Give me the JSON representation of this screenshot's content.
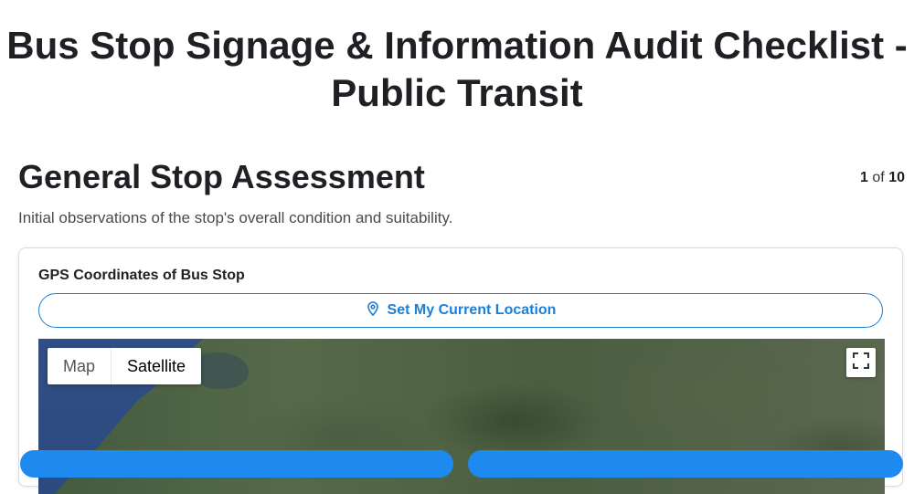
{
  "header": {
    "title": "Bus Stop Signage & Information Audit Checklist - Public Transit"
  },
  "section": {
    "title": "General Stop Assessment",
    "description": "Initial observations of the stop's overall condition and suitability.",
    "page_current": "1",
    "page_of": "of",
    "page_total": "10"
  },
  "gps_field": {
    "label": "GPS Coordinates of Bus Stop",
    "button_label": "Set My Current Location",
    "button_icon": "map-pin-icon"
  },
  "map": {
    "type_options": [
      "Map",
      "Satellite"
    ],
    "selected_type": "Satellite",
    "fullscreen_icon": "fullscreen-icon"
  },
  "colors": {
    "accent": "#1a7fd6",
    "primary_button": "#1e8af0"
  }
}
